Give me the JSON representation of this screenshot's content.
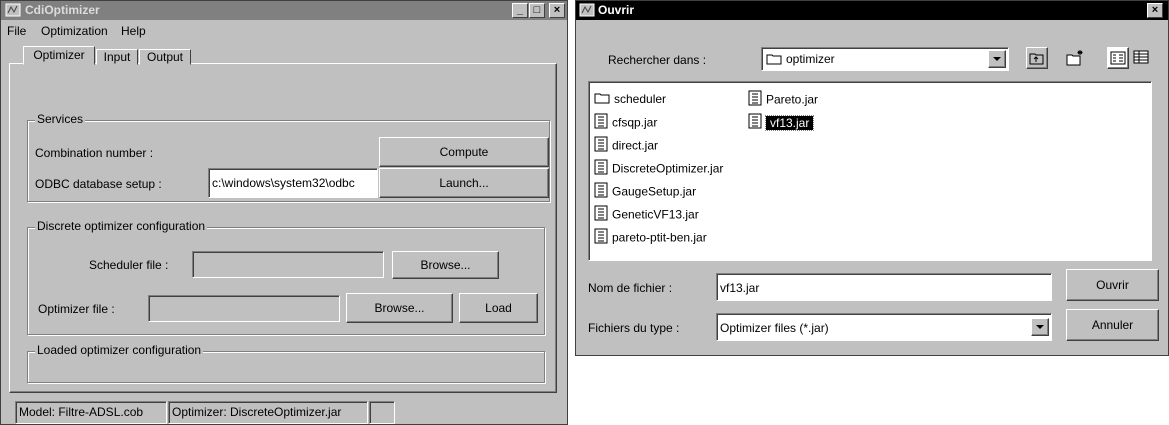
{
  "cdi_window": {
    "title": "CdiOptimizer",
    "menu": [
      "File",
      "Optimization",
      "Help"
    ],
    "tabs": [
      "Optimizer",
      "Input",
      "Output"
    ],
    "services": {
      "legend": "Services",
      "combination_label": "Combination number :",
      "compute_button": "Compute",
      "odbc_label": "ODBC database setup :",
      "odbc_value": "c:\\windows\\system32\\odbc",
      "launch_button": "Launch..."
    },
    "discrete": {
      "legend": "Discrete optimizer configuration",
      "scheduler_label": "Scheduler file :",
      "scheduler_value": "",
      "browse1": "Browse...",
      "optimizer_label": "Optimizer file :",
      "optimizer_value": "",
      "browse2": "Browse...",
      "load": "Load"
    },
    "loaded": {
      "legend": "Loaded optimizer configuration"
    },
    "status": {
      "model": "Model: Filtre-ADSL.cob",
      "optimizer": "Optimizer: DiscreteOptimizer.jar"
    }
  },
  "open_dialog": {
    "title": "Ouvrir",
    "lookin_label": "Rechercher dans :",
    "lookin_value": "optimizer",
    "files_col1": [
      {
        "name": "scheduler",
        "kind": "folder"
      },
      {
        "name": "cfsqp.jar",
        "kind": "jar"
      },
      {
        "name": "direct.jar",
        "kind": "jar"
      },
      {
        "name": "DiscreteOptimizer.jar",
        "kind": "jar"
      },
      {
        "name": "GaugeSetup.jar",
        "kind": "jar"
      },
      {
        "name": "GeneticVF13.jar",
        "kind": "jar"
      },
      {
        "name": "pareto-ptit-ben.jar",
        "kind": "jar"
      }
    ],
    "files_col2": [
      {
        "name": "Pareto.jar",
        "kind": "jar"
      },
      {
        "name": "vf13.jar",
        "kind": "jar",
        "selected": true
      }
    ],
    "filename_label": "Nom de fichier :",
    "filename_value": "vf13.jar",
    "filetype_label": "Fichiers du type :",
    "filetype_value": "Optimizer files (*.jar)",
    "open_button": "Ouvrir",
    "cancel_button": "Annuler"
  }
}
